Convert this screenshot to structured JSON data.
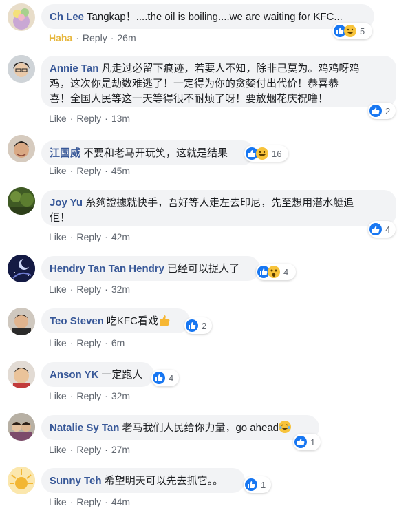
{
  "comments": [
    {
      "author": "Ch Lee",
      "text": "Tangkap！....the oil is boiling....we are waiting for KFC...",
      "reaction_label": "Haha",
      "reply_label": "Reply",
      "time": "26m",
      "reaction_count": "5"
    },
    {
      "author": "Annie Tan",
      "text_lines": [
        "凡走过必留下痕迹，若要人不知，除非己莫为。鸡鸡呀鸡",
        "鸡，这次你是劫数难逃了！一定得为你的贪婪付出代价！恭喜恭",
        "喜！全国人民等这一天等得很不耐烦了呀！要放烟花庆祝噜！"
      ],
      "like_label": "Like",
      "reply_label": "Reply",
      "time": "13m",
      "reaction_count": "2"
    },
    {
      "author": "江国威",
      "text": "不要和老马开玩笑，这就是结果",
      "like_label": "Like",
      "reply_label": "Reply",
      "time": "45m",
      "reaction_count": "16"
    },
    {
      "author": "Joy Yu",
      "text_lines": [
        "糸夠證據就快手，吾好等人走左去印尼，先至想用潜水艇追",
        "佢！"
      ],
      "like_label": "Like",
      "reply_label": "Reply",
      "time": "42m",
      "reaction_count": "4"
    },
    {
      "author": "Hendry Tan Tan Hendry",
      "text": "已经可以捉人了",
      "like_label": "Like",
      "reply_label": "Reply",
      "time": "32m",
      "reaction_count": "4"
    },
    {
      "author": "Teo Steven",
      "text": "吃KFC看戏",
      "like_label": "Like",
      "reply_label": "Reply",
      "time": "6m",
      "reaction_count": "2"
    },
    {
      "author": "Anson YK",
      "text": "一定跑人",
      "like_label": "Like",
      "reply_label": "Reply",
      "time": "32m",
      "reaction_count": "4"
    },
    {
      "author": "Natalie Sy Tan",
      "text": "老马我们人民给你力量，go ahead",
      "like_label": "Like",
      "reply_label": "Reply",
      "time": "27m",
      "reaction_count": "1"
    },
    {
      "author": "Sunny Teh",
      "text": "希望明天可以先去抓它。。",
      "like_label": "Like",
      "reply_label": "Reply",
      "time": "44m",
      "reaction_count": "1"
    }
  ],
  "colors": {
    "author": "#385898",
    "bubble": "#f2f3f5",
    "like_blue": "#1877f2",
    "haha_yellow": "#e7b73e"
  }
}
